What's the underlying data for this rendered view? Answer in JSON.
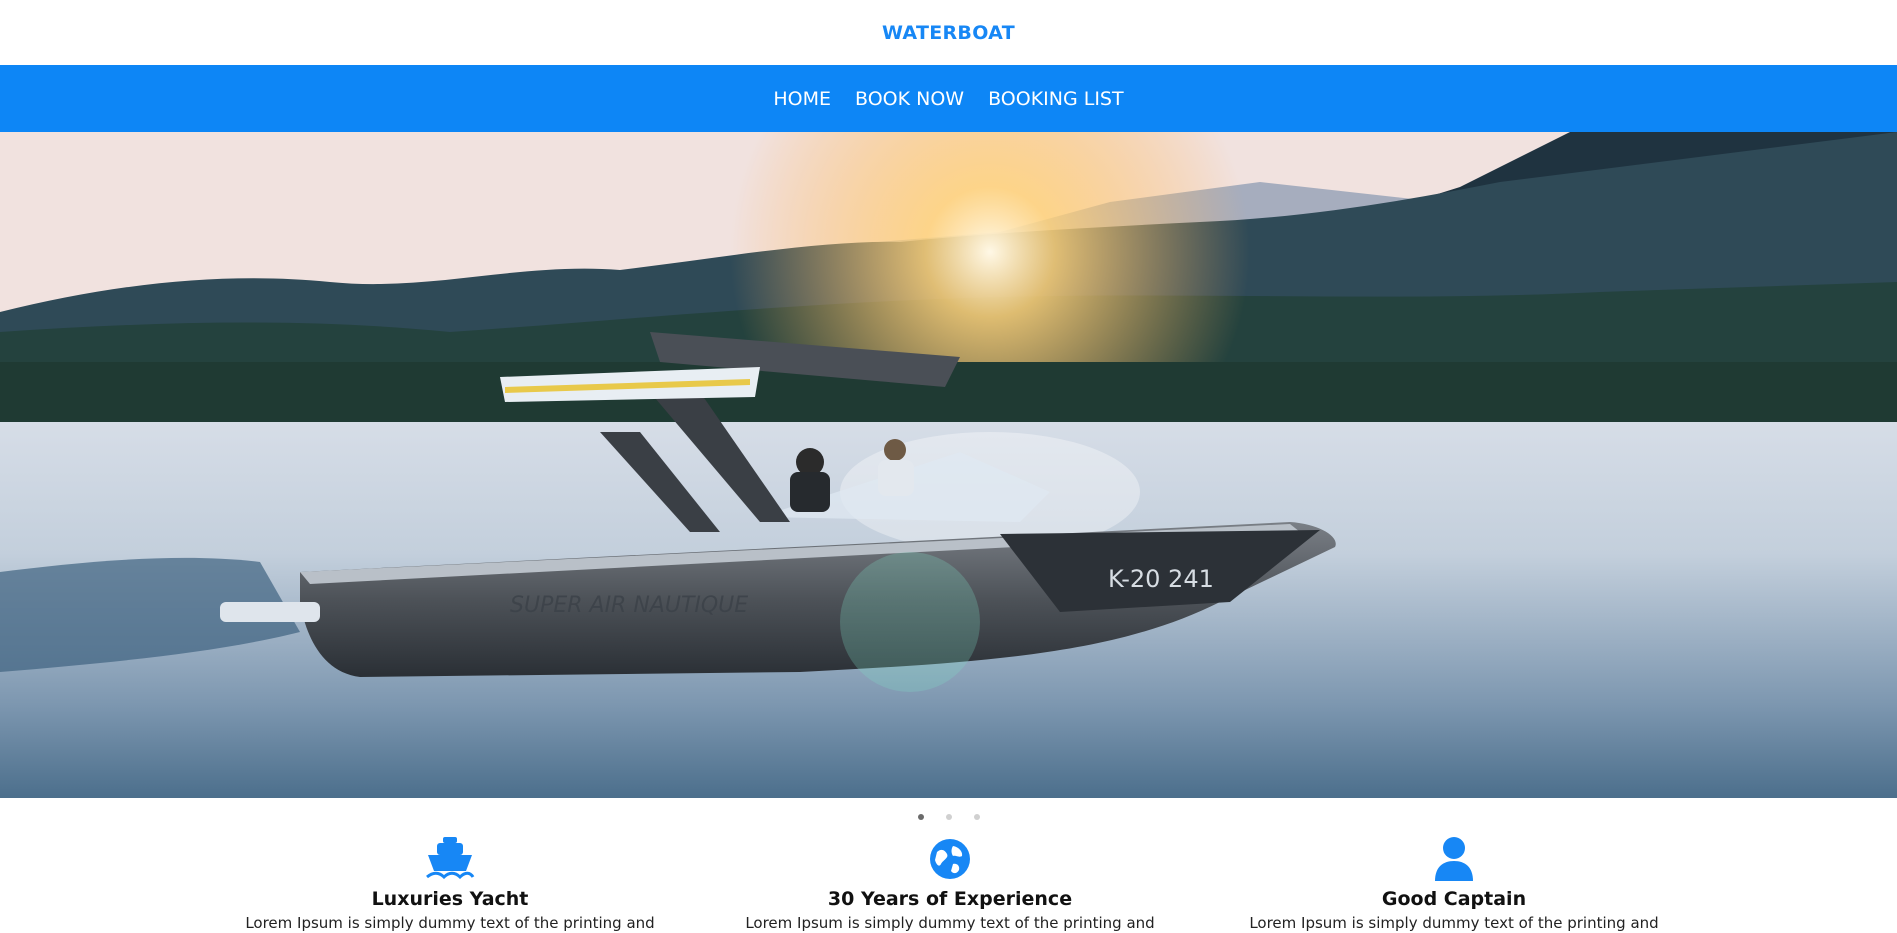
{
  "brand": {
    "name": "WATERBOAT"
  },
  "nav": {
    "items": [
      "HOME",
      "BOOK NOW",
      "BOOKING LIST"
    ]
  },
  "hero": {
    "boat_text": "SUPER AIR NAUTIQUE",
    "registration": "K-20 241"
  },
  "carousel": {
    "slides": 3,
    "active": 0
  },
  "features": [
    {
      "icon": "ship-icon",
      "title": "Luxuries Yacht",
      "text": "Lorem Ipsum is simply dummy text of the printing and"
    },
    {
      "icon": "globe-icon",
      "title": "30 Years of Experience",
      "text": "Lorem Ipsum is simply dummy text of the printing and"
    },
    {
      "icon": "user-icon",
      "title": "Good Captain",
      "text": "Lorem Ipsum is simply dummy text of the printing and"
    }
  ],
  "colors": {
    "accent": "#0d86f6",
    "brand": "#1787f5"
  }
}
